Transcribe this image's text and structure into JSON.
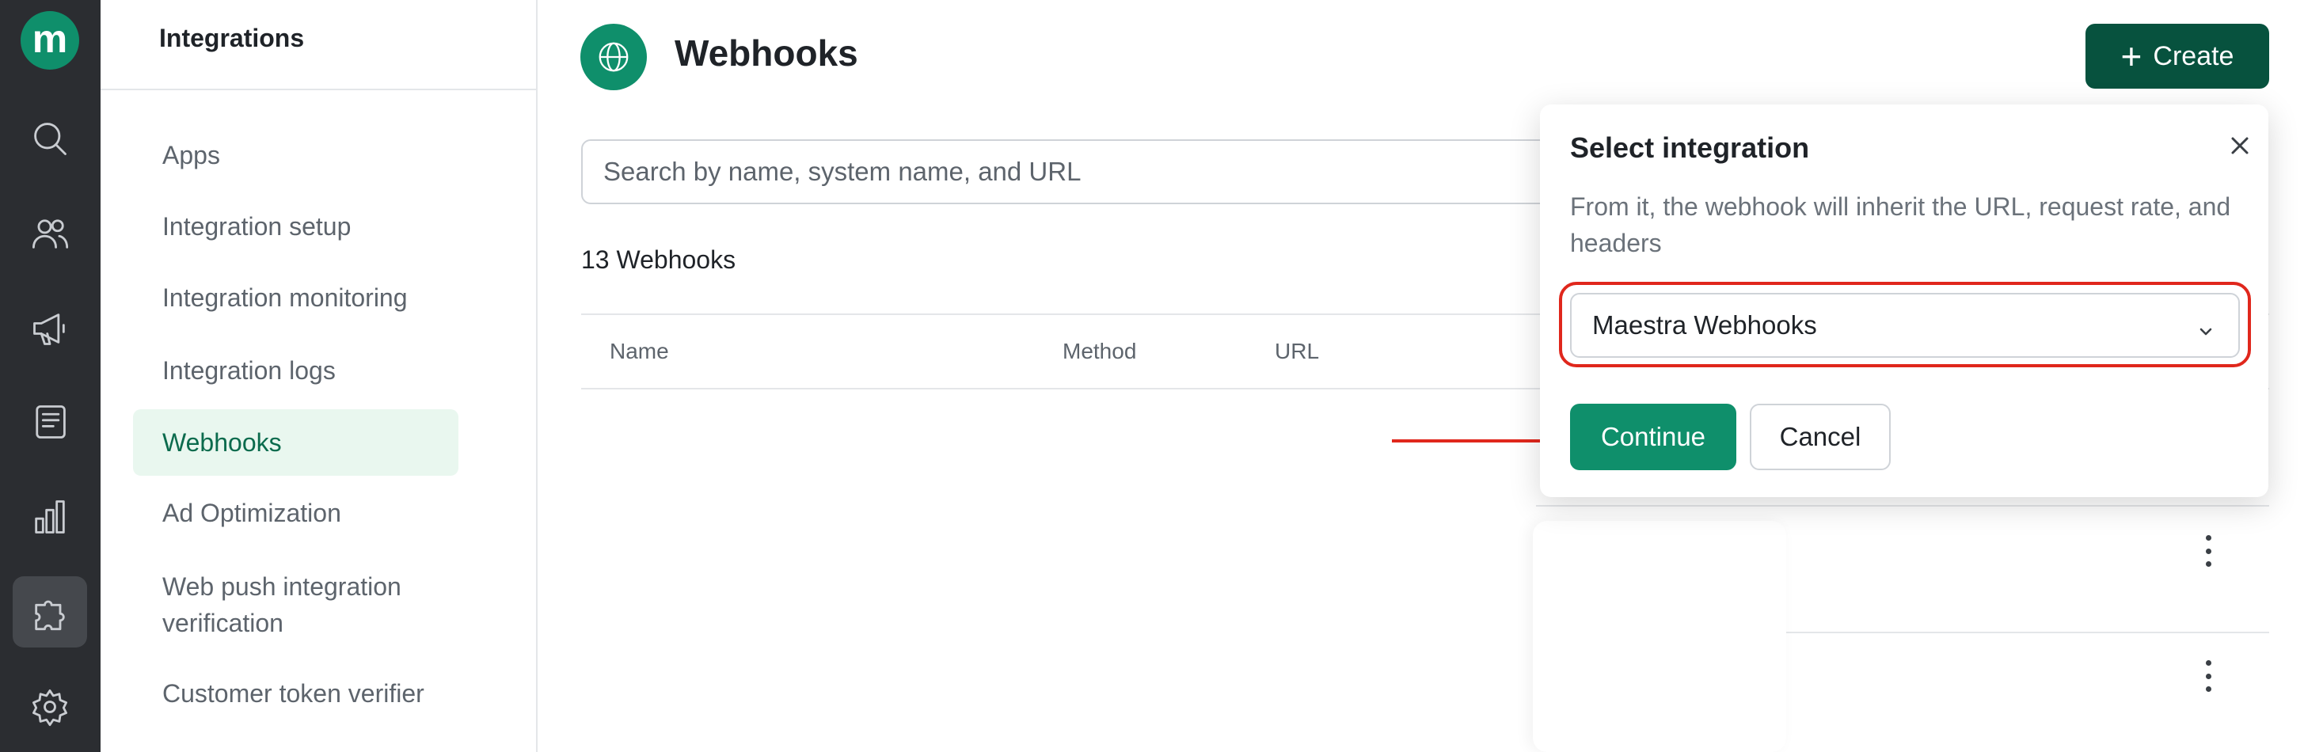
{
  "rail": {
    "logo": "m",
    "items": [
      {
        "icon": "search-icon"
      },
      {
        "icon": "users-icon"
      },
      {
        "icon": "megaphone-icon"
      },
      {
        "icon": "document-icon"
      },
      {
        "icon": "bar-chart-icon"
      },
      {
        "icon": "puzzle-icon",
        "active": true
      },
      {
        "icon": "gear-icon"
      }
    ]
  },
  "sidebar": {
    "title": "Integrations",
    "items": [
      {
        "label": "Apps"
      },
      {
        "label": "Integration setup"
      },
      {
        "label": "Integration monitoring"
      },
      {
        "label": "Integration logs"
      },
      {
        "label": "Webhooks",
        "active": true
      },
      {
        "label": "Ad Optimization"
      },
      {
        "label": "Web push integration verification"
      },
      {
        "label": "Customer token verifier"
      }
    ]
  },
  "header": {
    "title": "Webhooks",
    "create_label": "Create"
  },
  "search": {
    "placeholder": "Search by name, system name, and URL"
  },
  "table": {
    "count": "13 Webhooks",
    "columns": [
      "Name",
      "Method",
      "URL"
    ]
  },
  "popover": {
    "title": "Select integration",
    "description": "From it, the webhook will inherit the URL, request rate, and headers",
    "selected": "Maestra Webhooks",
    "continue_label": "Continue",
    "cancel_label": "Cancel"
  },
  "colors": {
    "accent": "#0f8f6b",
    "accent_dark": "#07523e",
    "highlight": "#e0271c",
    "rail": "#2b2d31"
  }
}
